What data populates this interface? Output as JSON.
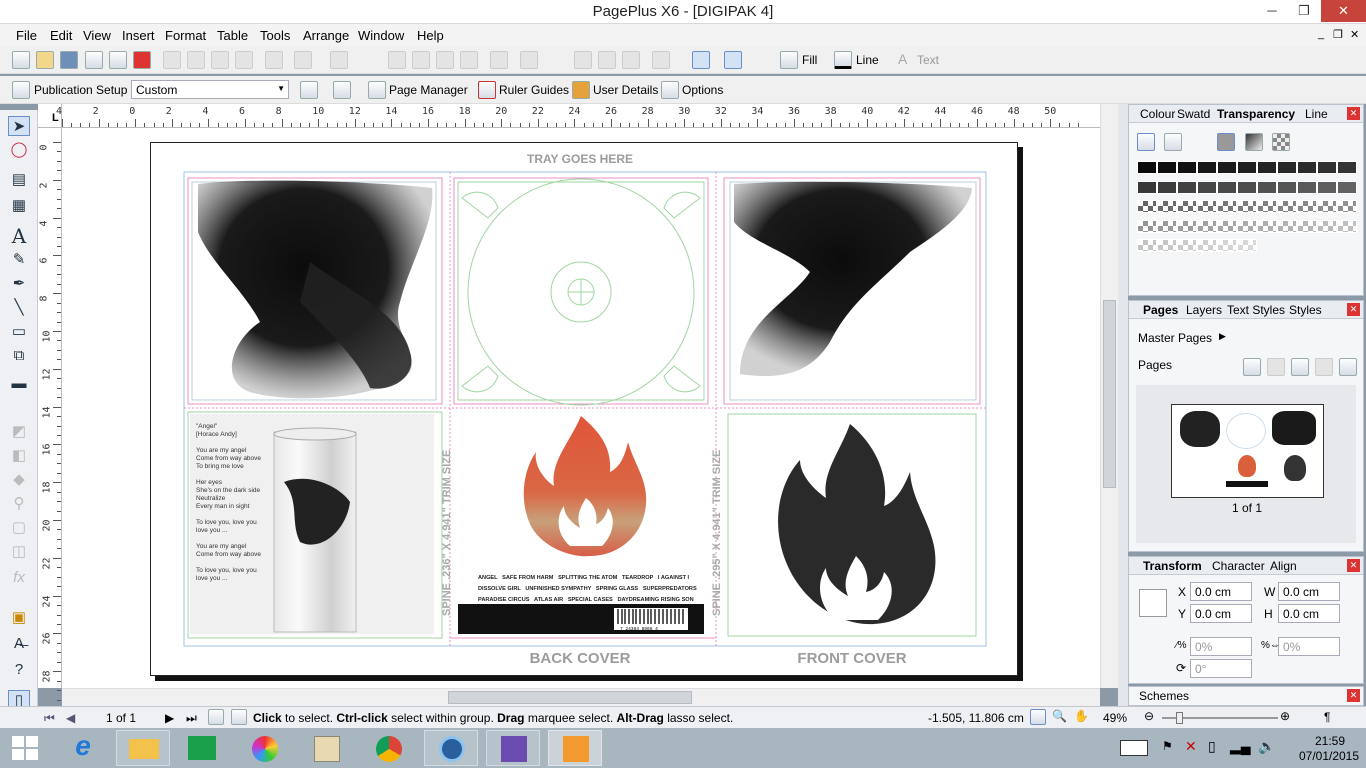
{
  "window": {
    "title": "PagePlus X6 - [DIGIPAK 4]",
    "minimize": "─",
    "restore": "❐",
    "close": "✕"
  },
  "menu": [
    "File",
    "Edit",
    "View",
    "Insert",
    "Format",
    "Table",
    "Tools",
    "Arrange",
    "Window",
    "Help"
  ],
  "doc_controls": {
    "min": "_",
    "restore": "❐",
    "close": "✕"
  },
  "toolbar1": {
    "fill_label": "Fill",
    "line_label": "Line",
    "text_label": "Text"
  },
  "toolbar2": {
    "publication_setup": "Publication Setup",
    "size_combo": "Custom",
    "page_manager": "Page Manager",
    "ruler_guides": "Ruler Guides",
    "user_details": "User Details",
    "options": "Options"
  },
  "ruler_h": [
    "4",
    "2",
    "0",
    "2",
    "4",
    "6",
    "8",
    "10",
    "12",
    "14",
    "16",
    "18",
    "20",
    "22",
    "24",
    "26",
    "28",
    "30",
    "32",
    "34",
    "36",
    "38",
    "40",
    "42",
    "44",
    "46",
    "48",
    "50"
  ],
  "ruler_h_corner": "L",
  "ruler_v": [
    "0",
    "2",
    "4",
    "6",
    "8",
    "10",
    "12",
    "14",
    "16",
    "18",
    "20",
    "22",
    "24",
    "26",
    "28"
  ],
  "canvas": {
    "tray_label": "TRAY GOES HERE",
    "back_label": "BACK COVER",
    "front_label": "FRONT COVER",
    "spine_left": "SPINE .236\" X 4.941\" TRIM SIZE",
    "spine_right": "SPINE .295\" X 4.941\" TRIM SIZE",
    "lyrics": "\"Angel\"\n[Horace Andy]\n\nYou are my angel\nCome from way above\nTo bring me love\n\nHer eyes\nShe's on the dark side\nNeutralize\nEvery man in sight\n\nTo love you, love you\nlove you ...\n\nYou are my angel\nCome from way above\n\nTo love you, love you\nlove you ...",
    "tracklist": "ANGEL   SAFE FROM HARM   SPLITTING THE ATOM   TEARDROP   I AGAINST I\nDISSOLVE GIRL   UNFINISHED SYMPATHY   SPRING GLASS   SUPERPREDATORS\nPARADISE CIRCUS   ATLAS AIR   SPECIAL CASES   DAYDREAMING RISING SON",
    "barcode_text": "7 24384 8988 4"
  },
  "colour_panel": {
    "tabs": [
      "Colour",
      "Swatd",
      "Transparency",
      "Line"
    ],
    "active": "Transparency"
  },
  "pages_panel": {
    "tabs": [
      "Pages",
      "Layers",
      "Text Styles",
      "Styles"
    ],
    "active": "Pages",
    "master_pages": "Master Pages",
    "pages": "Pages",
    "page_count": "1 of 1"
  },
  "transform_panel": {
    "tabs": [
      "Transform",
      "Character",
      "Align"
    ],
    "active": "Transform",
    "x_label": "X",
    "x_value": "0.0 cm",
    "y_label": "Y",
    "y_value": "0.0 cm",
    "w_label": "W",
    "w_value": "0.0 cm",
    "h_label": "H",
    "h_value": "0.0 cm",
    "skew_value": "0%",
    "scale_value": "0%",
    "rotate_value": "0°"
  },
  "schemes_panel": {
    "label": "Schemes"
  },
  "status": {
    "page": "1 of 1",
    "hint_click": "Click",
    "hint_1": " to select. ",
    "hint_ctrl": "Ctrl-click",
    "hint_2": " select within group. ",
    "hint_drag": "Drag",
    "hint_3": " marquee select. ",
    "hint_alt": "Alt-Drag",
    "hint_4": " lasso select.",
    "coords": "-1.505, 11.806 cm",
    "zoom": "49%"
  },
  "taskbar": {
    "time": "21:59",
    "date": "07/01/2015"
  },
  "colors": {
    "accent": "#6a8fc8",
    "guide_pink": "#e98fc4",
    "guide_blue": "#9ec3e6",
    "tray_green": "#9fd6a0",
    "flame_orange": "#d9603a"
  }
}
